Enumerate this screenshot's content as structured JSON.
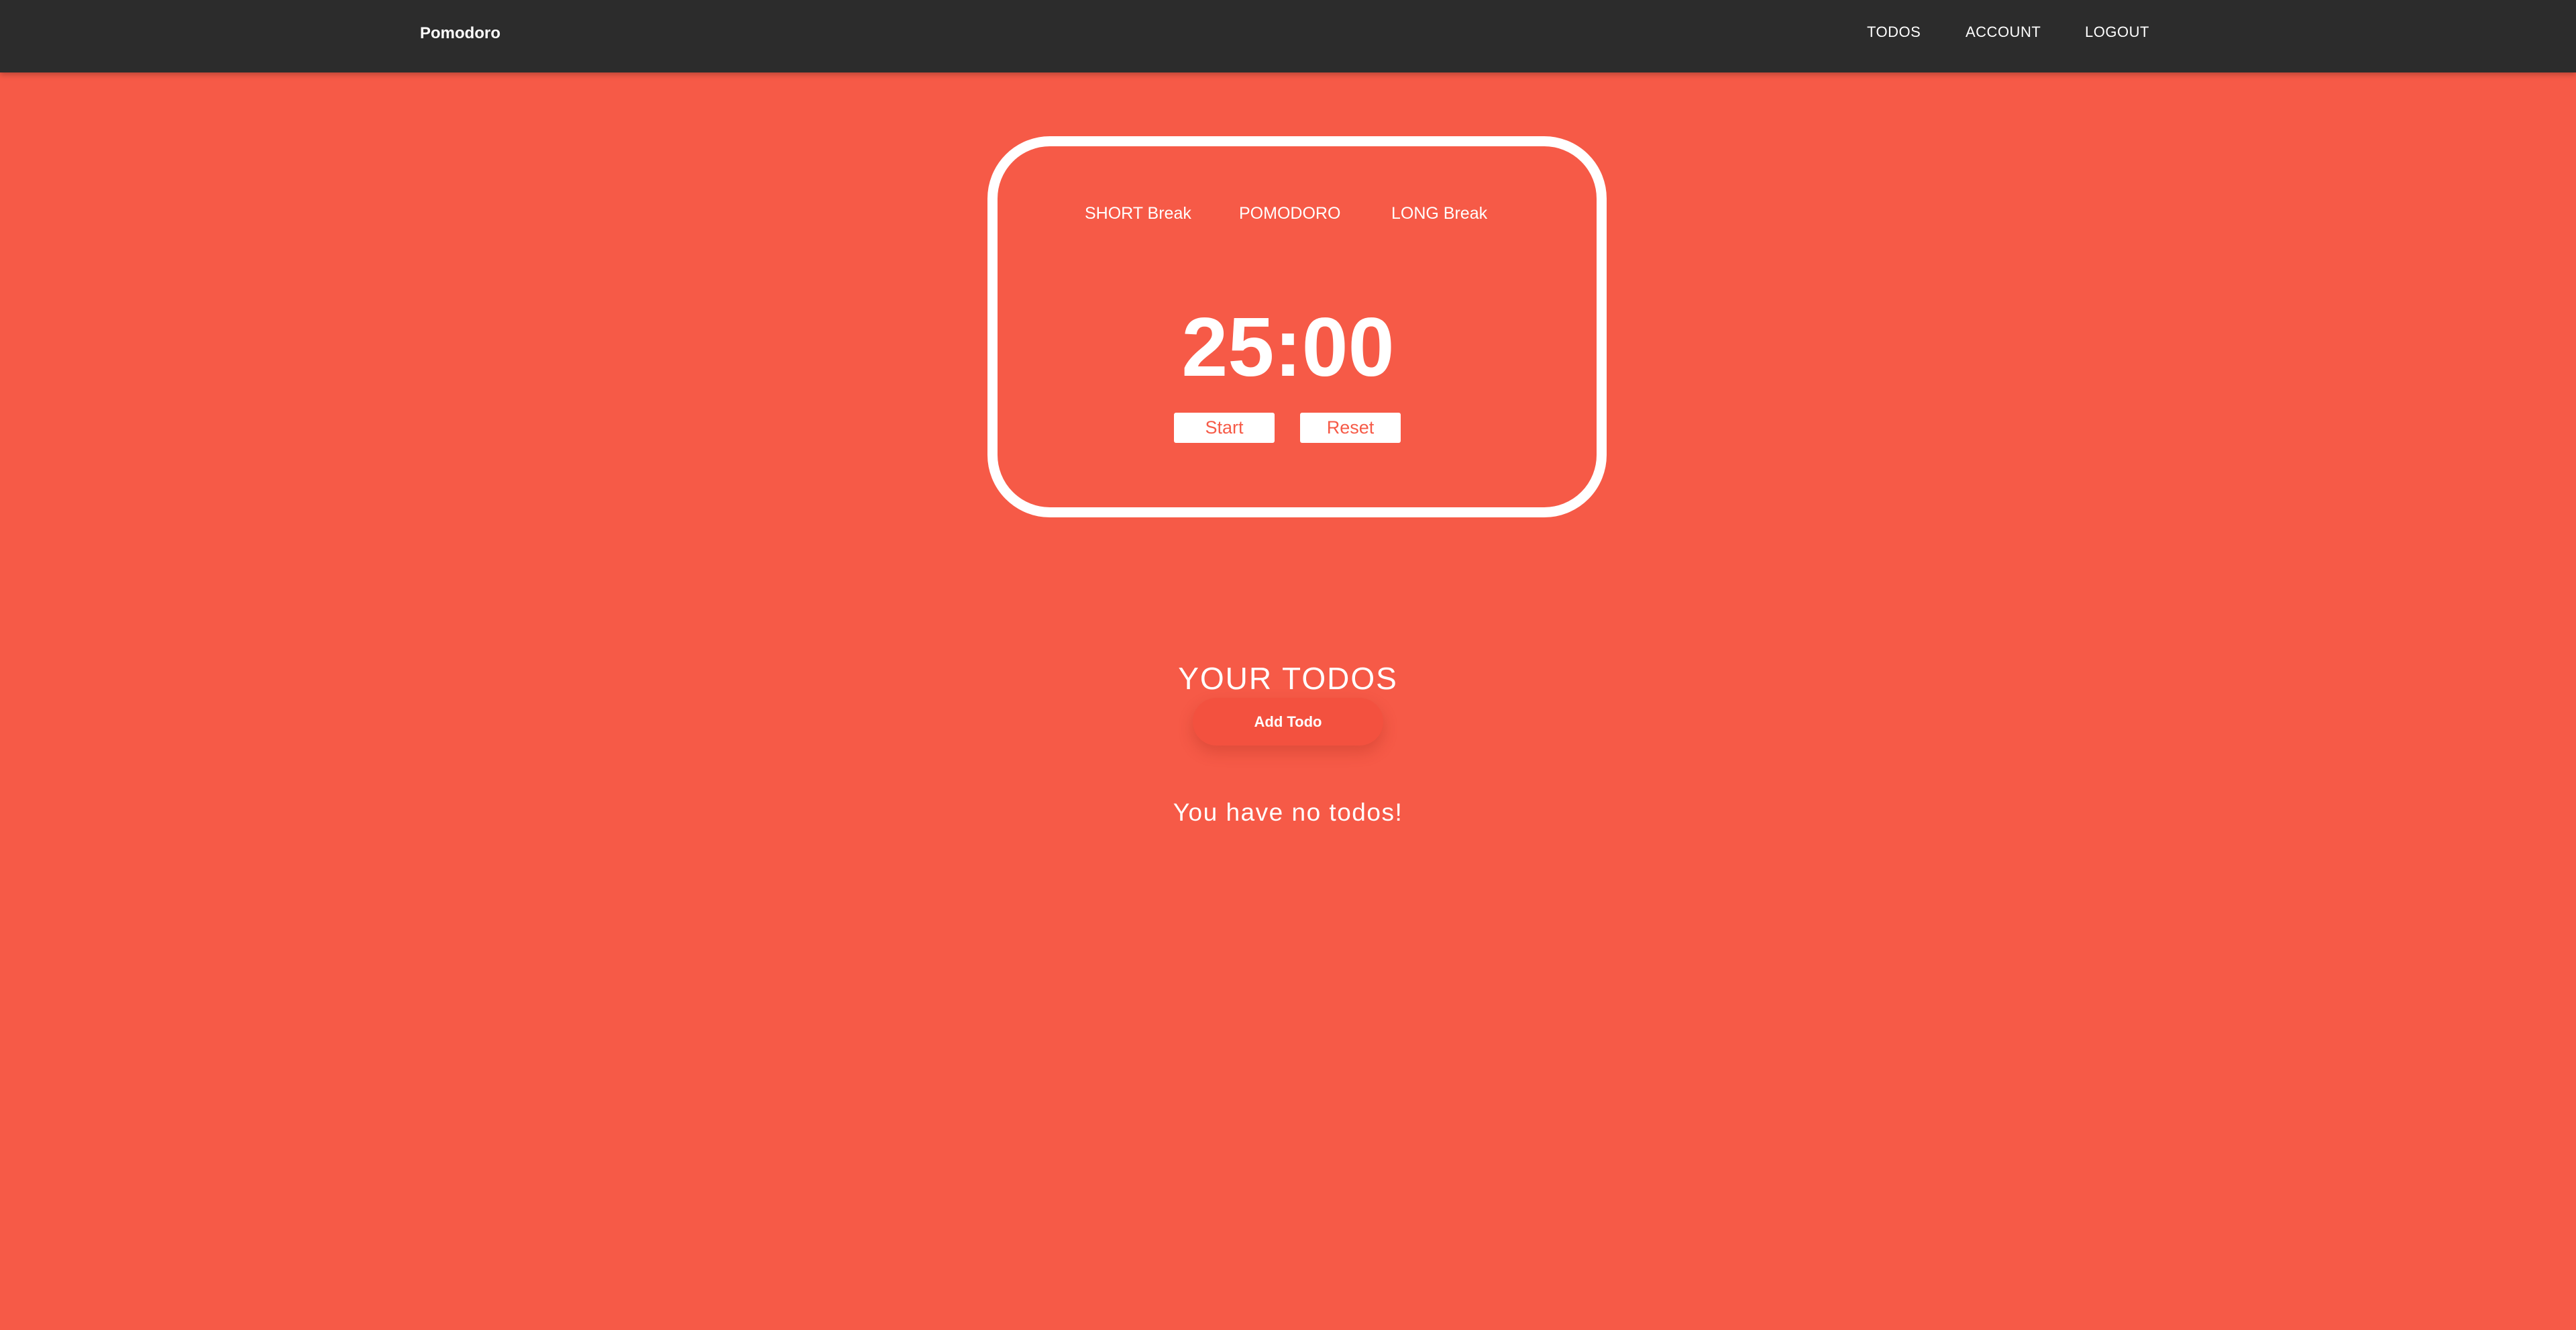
{
  "colors": {
    "background": "#F65A47",
    "navbar": "#2C2C2C",
    "accent": "#FFFFFF",
    "button_text": "#F65A47",
    "add_button": "#F3513F"
  },
  "navbar": {
    "brand": "Pomodoro",
    "links": [
      {
        "label": "TODOS"
      },
      {
        "label": "ACCOUNT"
      },
      {
        "label": "LOGOUT"
      }
    ]
  },
  "timer": {
    "modes": [
      {
        "label": "SHORT Break"
      },
      {
        "label": "POMODORO"
      },
      {
        "label": "LONG Break"
      }
    ],
    "display": "25:00",
    "start_label": "Start",
    "reset_label": "Reset"
  },
  "todos": {
    "title": "YOUR TODOS",
    "add_label": "Add Todo",
    "empty_message": "You have no todos!"
  }
}
